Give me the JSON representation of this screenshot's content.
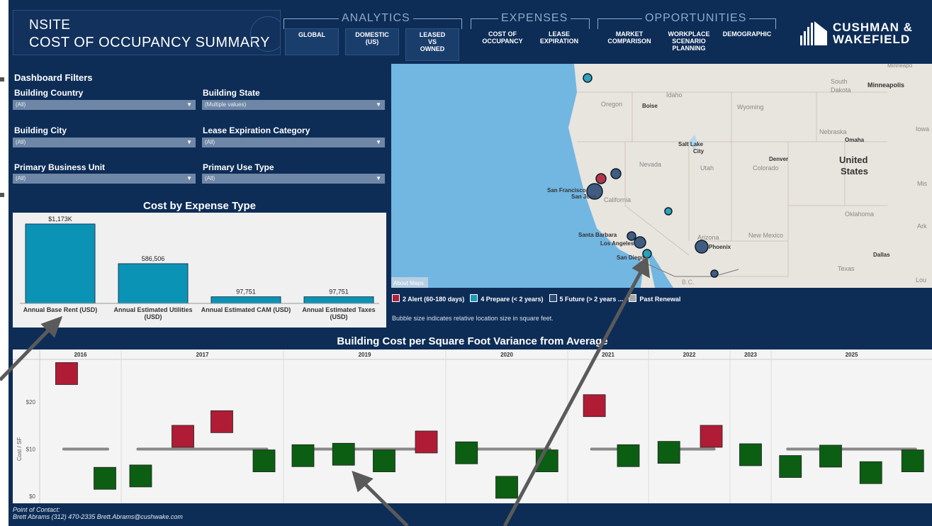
{
  "header": {
    "title_line1": "NSITE",
    "title_line2": "COST OF OCCUPANCY SUMMARY",
    "groups": [
      "ANALYTICS",
      "EXPENSES",
      "OPPORTUNITIES"
    ],
    "nav": [
      {
        "label": "GLOBAL"
      },
      {
        "label": "DOMESTIC\n(US)"
      },
      {
        "label": "LEASED\nVS\nOWNED"
      },
      {
        "label": "COST OF\nOCCUPANCY"
      },
      {
        "label": "LEASE\nEXPIRATION"
      },
      {
        "label": "MARKET\nCOMPARISON"
      },
      {
        "label": "WORKPLACE\nSCENARIO\nPLANNING"
      },
      {
        "label": "DEMOGRAPHIC"
      }
    ],
    "logo_line1": "CUSHMAN &",
    "logo_line2": "WAKEFIELD"
  },
  "filters": {
    "title": "Dashboard Filters",
    "items": [
      {
        "label": "Building Country",
        "value": "(All)"
      },
      {
        "label": "Building State",
        "value": "(Multiple values)"
      },
      {
        "label": "Building City",
        "value": "(All)"
      },
      {
        "label": "Lease Expiration Category",
        "value": "(All)"
      },
      {
        "label": "Primary Business Unit",
        "value": "(All)"
      },
      {
        "label": "Primary Use Type",
        "value": "(All)"
      }
    ]
  },
  "map": {
    "labels": [
      "Minneapolis",
      "South Dakota",
      "Idaho",
      "Oregon",
      "Boise",
      "Wyoming",
      "Nebraska",
      "Omaha",
      "Iowa",
      "Salt Lake City",
      "Denver",
      "United States",
      "Nevada",
      "Utah",
      "Colorado",
      "San Francisco",
      "San Jose",
      "California",
      "Oklahoma",
      "Santa Barbara",
      "Los Angeles",
      "Arizona",
      "New Mexico",
      "Phoenix",
      "San Diego",
      "Dallas",
      "Texas",
      "B.C.",
      "Mis",
      "Ark",
      "Lou",
      "Minneapo"
    ],
    "attribution": "About Maps",
    "legend": [
      {
        "label": "2 Alert (60-180 days)",
        "color": "#b0203a"
      },
      {
        "label": "4 Prepare (< 2 years)",
        "color": "#1a9bb5"
      },
      {
        "label": "5 Future (> 2 years ...",
        "color": "#2e4d75"
      },
      {
        "label": "Past Renewal",
        "color": "#a8a8a8"
      }
    ],
    "note": "Bubble size indicates relative location size in square feet."
  },
  "chart_data": [
    {
      "type": "bar",
      "title": "Cost by Expense Type",
      "categories": [
        "Annual Base Rent (USD)",
        "Annual Estimated Utilities\n(USD)",
        "Annual Estimated CAM (USD)",
        "Annual Estimated Taxes\n(USD)"
      ],
      "values": [
        1173000,
        586506,
        97751,
        97751
      ],
      "data_labels": [
        "$1,173K",
        "586,506",
        "97,751",
        "97,751"
      ],
      "color": "#0b93b6"
    },
    {
      "type": "scatter",
      "title": "Building Cost per Square Foot Variance from Average",
      "ylabel": "Cost / SF",
      "yticks": [
        "$0",
        "$10",
        "$20"
      ],
      "ylim": [
        -1.5,
        29
      ],
      "years": [
        "2016",
        "2017",
        "2019",
        "2020",
        "2021",
        "2022",
        "2023",
        "2025"
      ],
      "average": 10,
      "points": [
        {
          "year": "2016",
          "slot": 0.33,
          "y": 26,
          "status": "above"
        },
        {
          "year": "2016",
          "slot": 0.8,
          "y": 3.8,
          "status": "below"
        },
        {
          "year": "2017",
          "slot": 0.12,
          "y": 4.3,
          "status": "below"
        },
        {
          "year": "2017",
          "slot": 0.38,
          "y": 12.7,
          "status": "above"
        },
        {
          "year": "2017",
          "slot": 0.62,
          "y": 15.8,
          "status": "above"
        },
        {
          "year": "2017",
          "slot": 0.88,
          "y": 7.5,
          "status": "below"
        },
        {
          "year": "2019",
          "slot": 0.12,
          "y": 8.6,
          "status": "below"
        },
        {
          "year": "2019",
          "slot": 0.37,
          "y": 8.9,
          "status": "below"
        },
        {
          "year": "2019",
          "slot": 0.62,
          "y": 7.5,
          "status": "below"
        },
        {
          "year": "2019",
          "slot": 0.88,
          "y": 11.5,
          "status": "above"
        },
        {
          "year": "2020",
          "slot": 0.17,
          "y": 9.2,
          "status": "below"
        },
        {
          "year": "2020",
          "slot": 0.5,
          "y": 1.9,
          "status": "below"
        },
        {
          "year": "2020",
          "slot": 0.83,
          "y": 7.5,
          "status": "below"
        },
        {
          "year": "2021",
          "slot": 0.33,
          "y": 19.2,
          "status": "above"
        },
        {
          "year": "2021",
          "slot": 0.75,
          "y": 8.6,
          "status": "below"
        },
        {
          "year": "2022",
          "slot": 0.25,
          "y": 9.3,
          "status": "below"
        },
        {
          "year": "2022",
          "slot": 0.77,
          "y": 12.7,
          "status": "above"
        },
        {
          "year": "2023",
          "slot": 0.5,
          "y": 8.8,
          "status": "below"
        },
        {
          "year": "2025",
          "slot": 0.12,
          "y": 6.3,
          "status": "below"
        },
        {
          "year": "2025",
          "slot": 0.37,
          "y": 8.5,
          "status": "below"
        },
        {
          "year": "2025",
          "slot": 0.62,
          "y": 5.0,
          "status": "below"
        },
        {
          "year": "2025",
          "slot": 0.88,
          "y": 7.5,
          "status": "below"
        }
      ],
      "colors": {
        "above": "#b01c36",
        "below": "#0b5e12",
        "average": "#888888"
      }
    }
  ],
  "footer": {
    "contact_line1": "Point of Contact:",
    "contact_line2": "Brett Abrams (312) 470-2335 Brett.Abrams@cushwake.com"
  }
}
